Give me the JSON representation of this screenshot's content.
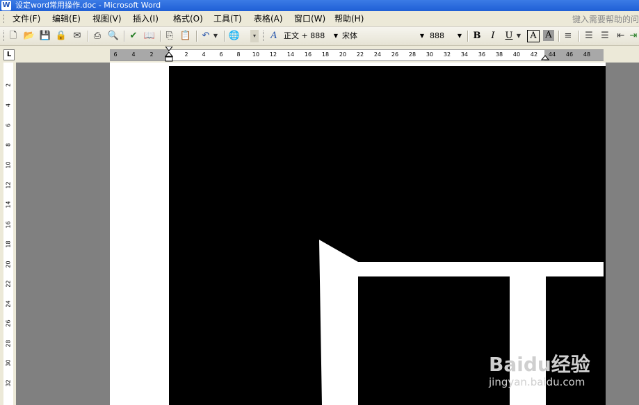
{
  "window": {
    "title": "设定word常用操作.doc - Microsoft Word",
    "app_icon": "W"
  },
  "menubar": {
    "items": [
      "文件(F)",
      "编辑(E)",
      "视图(V)",
      "插入(I)",
      "格式(O)",
      "工具(T)",
      "表格(A)",
      "窗口(W)",
      "帮助(H)"
    ],
    "help_search_placeholder": "键入需要帮助的问"
  },
  "toolbar": {
    "icons": [
      "new-document-icon",
      "open-icon",
      "save-icon",
      "permission-icon",
      "email-icon",
      "print-icon",
      "print-preview-icon",
      "spelling-icon",
      "research-icon",
      "copy-icon",
      "paste-icon",
      "undo-icon",
      "web-icon"
    ],
    "style_icon": "A",
    "style_value": "正文 + 888",
    "font_value": "宋体",
    "size_value": "888",
    "bold": "B",
    "italic": "I",
    "underline": "U",
    "char_border": "A",
    "char_shading": "A"
  },
  "ruler": {
    "tab_selector": "L",
    "horizontal_ticks": [
      "6",
      "4",
      "2",
      "2",
      "4",
      "6",
      "8",
      "10",
      "12",
      "14",
      "16",
      "18",
      "20",
      "22",
      "24",
      "26",
      "28",
      "30",
      "32",
      "34",
      "36",
      "38",
      "40",
      "42",
      "44",
      "46",
      "48"
    ],
    "vertical_ticks": [
      "2",
      "4",
      "6",
      "8",
      "10",
      "12",
      "14",
      "16",
      "18",
      "20",
      "22",
      "24",
      "26",
      "28",
      "30",
      "32"
    ]
  },
  "watermark": {
    "logo_text": "Baidu经验",
    "url": "jingyan.baidu.com"
  },
  "colors": {
    "titlebar": "#2b6ee0",
    "chrome": "#ece9d8",
    "workspace": "#808080",
    "page": "#ffffff",
    "image_fill": "#000000"
  }
}
